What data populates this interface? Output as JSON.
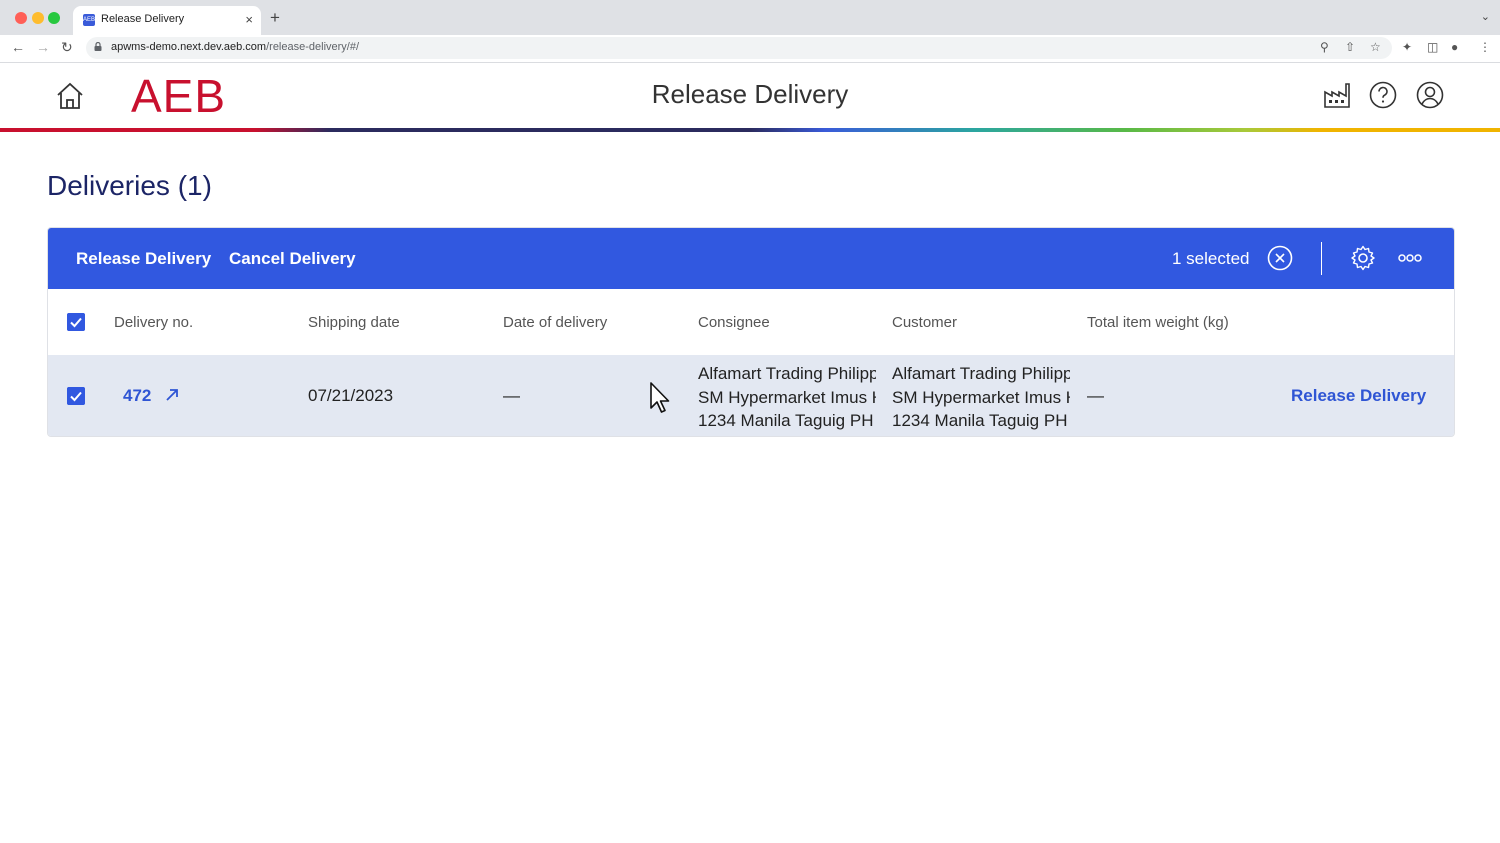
{
  "browser": {
    "tab_title": "Release Delivery",
    "favicon_text": "AEB",
    "new_tab_label": "+",
    "close_tab_label": "×",
    "url_host": "apwms-demo.next.dev.aeb.com",
    "url_path": "/release-delivery/#/"
  },
  "header": {
    "logo": "AEB",
    "title": "Release Delivery",
    "icons": [
      "home-icon",
      "warehouse-icon",
      "help-icon",
      "user-account-icon"
    ]
  },
  "section": {
    "title": "Deliveries (1)"
  },
  "actionbar": {
    "release_label": "Release Delivery",
    "cancel_label": "Cancel Delivery",
    "selected_text": "1 selected",
    "icons": [
      "clear-selection-icon",
      "settings-icon",
      "more-options-icon"
    ]
  },
  "table": {
    "columns": [
      "Delivery no.",
      "Shipping date",
      "Date of delivery",
      "Consignee",
      "Customer",
      "Total item weight (kg)"
    ],
    "rows": [
      {
        "selected": true,
        "delivery_no": "472",
        "shipping_date": "07/21/2023",
        "date_of_delivery": "—",
        "consignee": [
          "Alfamart Trading Philipp",
          "SM Hypermarket Imus H",
          "1234 Manila Taguig PH"
        ],
        "customer": [
          "Alfamart Trading Philipp",
          "SM Hypermarket Imus H",
          "1234 Manila Taguig PH"
        ],
        "total_weight": "—",
        "row_action": "Release Delivery"
      }
    ]
  },
  "colors": {
    "accent": "#3158e0",
    "brand_red": "#c8102e",
    "title_navy": "#1c2566",
    "row_selected_bg": "#e3e8f2"
  }
}
